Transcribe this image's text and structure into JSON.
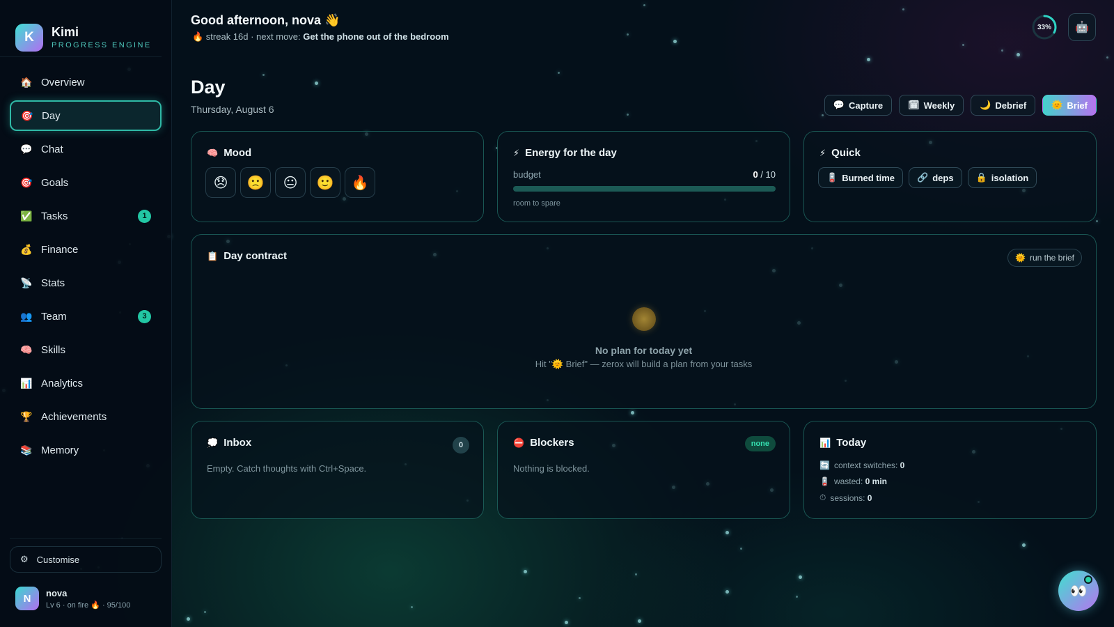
{
  "brand": {
    "logo_letter": "K",
    "name": "Kimi",
    "subtitle": "PROGRESS ENGINE"
  },
  "sidebar": {
    "items": [
      {
        "label": "Overview",
        "icon": "🏠",
        "icon_name": "home-icon"
      },
      {
        "label": "Day",
        "icon": "🎯",
        "icon_name": "target-icon",
        "active": true
      },
      {
        "label": "Chat",
        "icon": "💬",
        "icon_name": "chat-icon"
      },
      {
        "label": "Goals",
        "icon": "🎯",
        "icon_name": "target-icon"
      },
      {
        "label": "Tasks",
        "icon": "✅",
        "icon_name": "check-icon",
        "badge": "1"
      },
      {
        "label": "Finance",
        "icon": "💰",
        "icon_name": "money-bag-icon"
      },
      {
        "label": "Stats",
        "icon": "📡",
        "icon_name": "satellite-icon"
      },
      {
        "label": "Team",
        "icon": "👥",
        "icon_name": "team-icon",
        "badge": "3"
      },
      {
        "label": "Skills",
        "icon": "🧠",
        "icon_name": "brain-icon"
      },
      {
        "label": "Analytics",
        "icon": "📊",
        "icon_name": "bar-chart-icon"
      },
      {
        "label": "Achievements",
        "icon": "🏆",
        "icon_name": "trophy-icon"
      },
      {
        "label": "Memory",
        "icon": "📚",
        "icon_name": "books-icon"
      }
    ],
    "customise": {
      "icon": "⚙",
      "label": "Customise"
    },
    "user": {
      "initial": "N",
      "name": "nova",
      "meta": "Lv 6 · on fire 🔥 · 95/100"
    }
  },
  "header": {
    "greeting": "Good afternoon, nova 👋",
    "streak_prefix": "🔥 streak 16d · next move: ",
    "next_move": "Get the phone out of the bedroom",
    "progress_label": "33%",
    "progress_value": 0.33,
    "bot_icon": "🤖"
  },
  "page": {
    "title": "Day",
    "date": "Thursday, August 6"
  },
  "actions": [
    {
      "icon": "💬",
      "label": "Capture",
      "icon_name": "speech-bubble-icon"
    },
    {
      "icon": "🗓",
      "label": "Weekly",
      "icon_name": "calendar-icon"
    },
    {
      "icon": "🌙",
      "label": "Debrief",
      "icon_name": "moon-icon"
    },
    {
      "icon": "🌞",
      "label": "Brief",
      "icon_name": "sun-icon",
      "primary": true
    }
  ],
  "mood": {
    "icon": "🧠",
    "title": "Mood",
    "options": [
      "😞",
      "🙁",
      "😐",
      "🙂",
      "🔥"
    ]
  },
  "energy": {
    "icon": "⚡",
    "title": "Energy for the day",
    "budget_label": "budget",
    "used": "0",
    "total": "/ 10",
    "fill": 0,
    "note": "room to spare"
  },
  "quick": {
    "icon": "⚡",
    "title": "Quick",
    "chips": [
      {
        "icon": "🪫",
        "label": "Burned time"
      },
      {
        "icon": "🔗",
        "label": "deps"
      },
      {
        "icon": "🔒",
        "label": "isolation"
      }
    ]
  },
  "contract": {
    "icon": "📋",
    "title": "Day contract",
    "run_icon": "🌞",
    "run_label": "run the brief",
    "empty_title": "No plan for today yet",
    "empty_sub": "Hit \"🌞 Brief\" — zerox will build a plan from your tasks"
  },
  "inbox": {
    "icon": "💭",
    "title": "Inbox",
    "count": "0",
    "empty": "Empty. Catch thoughts with Ctrl+Space."
  },
  "blockers": {
    "icon": "⛔",
    "title": "Blockers",
    "pill": "none",
    "empty": "Nothing is blocked."
  },
  "today": {
    "icon": "📊",
    "title": "Today",
    "stats": [
      {
        "icon": "🔄",
        "label": "context switches: ",
        "value": "0"
      },
      {
        "icon": "🪫",
        "label": "wasted: ",
        "value": "0 min"
      },
      {
        "icon": "⏱",
        "label": "sessions: ",
        "value": "0"
      }
    ]
  },
  "fab": {
    "icon": "👀"
  },
  "colors": {
    "accent": "#2fd3b4",
    "brand_start": "#3de0d2",
    "brand_end": "#b36cf2",
    "background": "#04101a"
  }
}
